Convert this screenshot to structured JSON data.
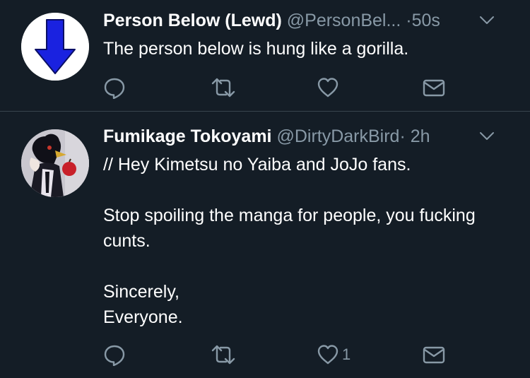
{
  "tweets": [
    {
      "display_name": "Person Below (Lewd)",
      "handle": "@PersonBel...",
      "separator": "·",
      "time": "50s",
      "text": "The person below is hung like a gorilla.",
      "like_count": ""
    },
    {
      "display_name": "Fumikage Tokoyami",
      "handle": "@DirtyDarkBird",
      "separator": "·",
      "time": "2h",
      "text": "// Hey Kimetsu no Yaiba and JoJo fans.\n\nStop spoiling the manga for people, you fucking cunts.\n\nSincerely,\nEveryone.",
      "like_count": "1"
    }
  ],
  "colors": {
    "background": "#141d26",
    "divider": "#38444d",
    "secondary_text": "#8899a6",
    "arrow_blue": "#1a22e0"
  },
  "icons": [
    "blue-down-arrow-avatar",
    "crow-character-avatar",
    "chevron-down-icon",
    "reply-icon",
    "retweet-icon",
    "like-icon",
    "direct-message-icon"
  ]
}
